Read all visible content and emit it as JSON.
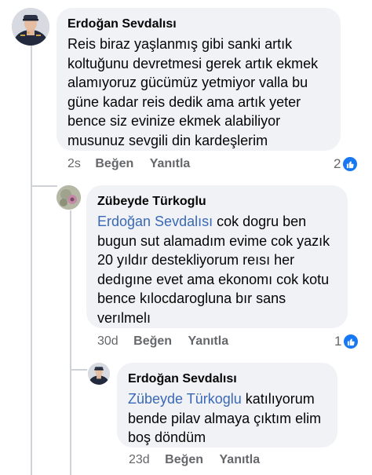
{
  "comments": [
    {
      "author": "Erdoğan Sevdalısı",
      "text": "Reis biraz yaşlanmış gibi sanki artık koltuğunu devretmesi gerek artık ekmek alamıyoruz gücümüz yetmiyor valla bu güne kadar reis dedik ama artık yeter bence siz evinize ekmek alabiliyor musunuz sevgili din kardeşlerim",
      "time": "2s",
      "like_label": "Beğen",
      "reply_label": "Yanıtla",
      "reaction_count": "2"
    },
    {
      "author": "Zübeyde Türkoglu",
      "mention": "Erdoğan Sevdalısı",
      "text": " cok dogru ben bugun sut alamadım evime cok yazık 20 yıldır destekliyorum reısı her dedıgıne evet ama ekonomı cok kotu bence kılocdarogluna bır sans verılmelı",
      "time": "30d",
      "like_label": "Beğen",
      "reply_label": "Yanıtla",
      "reaction_count": "1"
    },
    {
      "author": "Erdoğan Sevdalısı",
      "mention": "Zübeyde Türkoglu",
      "text": " katılıyorum bende pilav almaya çıktım elim boş döndüm",
      "time": "23d",
      "like_label": "Beğen",
      "reply_label": "Yanıtla"
    }
  ],
  "colors": {
    "bubble": "#f0f2f5",
    "mention": "#3a68b6",
    "meta": "#65676b",
    "like": "#1877f2"
  },
  "icons": {
    "reaction": "like-thumb-icon"
  }
}
